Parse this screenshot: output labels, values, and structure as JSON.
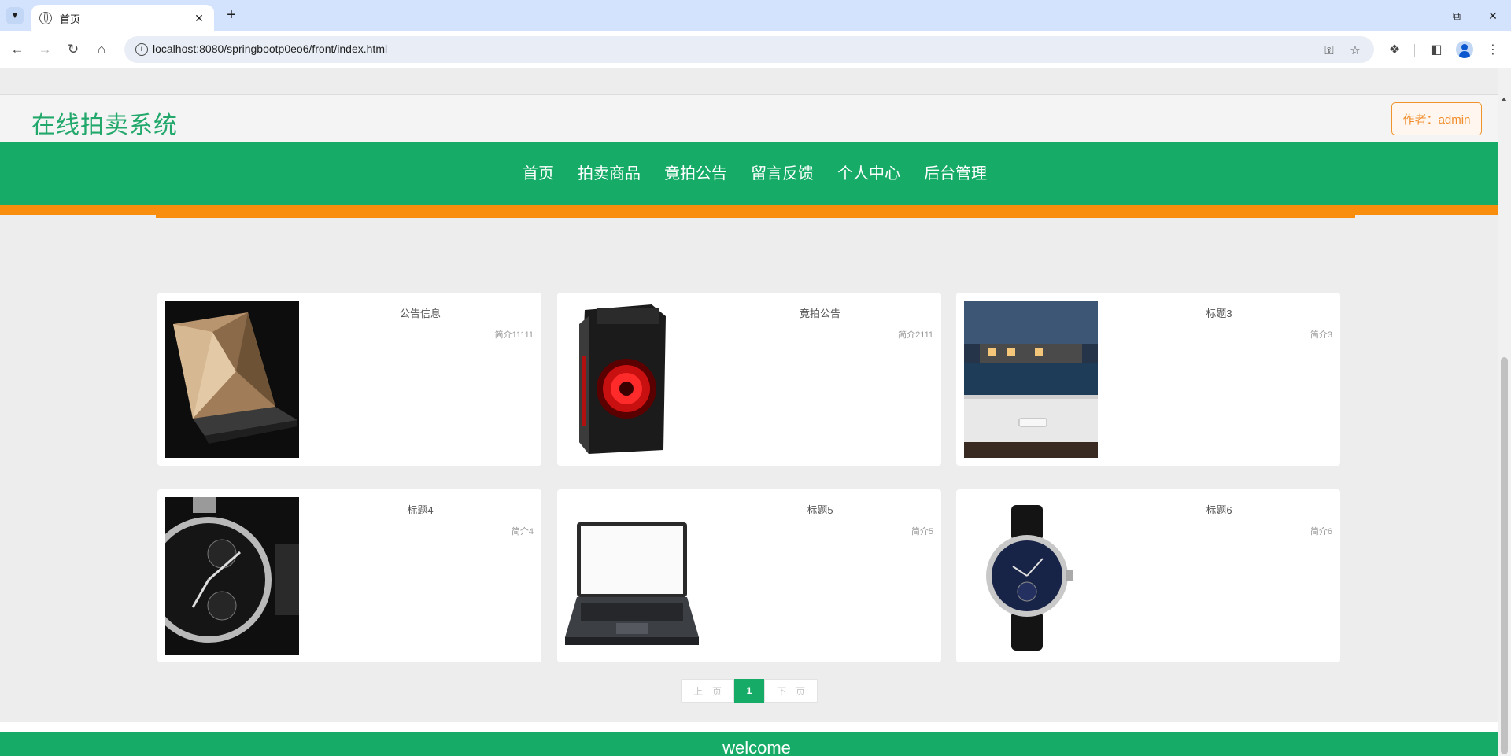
{
  "browser": {
    "tab_title": "首页",
    "url": "localhost:8080/springbootp0eo6/front/index.html"
  },
  "site": {
    "title": "在线拍卖系统",
    "author_label": "作者：admin"
  },
  "nav": {
    "items": [
      {
        "label": "首页"
      },
      {
        "label": "拍卖商品"
      },
      {
        "label": "竟拍公告"
      },
      {
        "label": "留言反馈"
      },
      {
        "label": "个人中心"
      },
      {
        "label": "后台管理"
      }
    ]
  },
  "cards": [
    {
      "title": "公告信息",
      "subtitle": "简介11111",
      "image": "laptop-gold"
    },
    {
      "title": "竟拍公告",
      "subtitle": "简介2111",
      "image": "pc-case-red-fan"
    },
    {
      "title": "标题3",
      "subtitle": "简介3",
      "image": "projector-villa"
    },
    {
      "title": "标题4",
      "subtitle": "简介4",
      "image": "chronograph-watch"
    },
    {
      "title": "标题5",
      "subtitle": "简介5",
      "image": "laptop-open"
    },
    {
      "title": "标题6",
      "subtitle": "简介6",
      "image": "leather-watch"
    }
  ],
  "pagination": {
    "prev": "上一页",
    "current": "1",
    "next": "下一页"
  },
  "footer": {
    "text": "welcome"
  },
  "colors": {
    "brand_green": "#16ab66",
    "accent_orange": "#f88d0e"
  }
}
